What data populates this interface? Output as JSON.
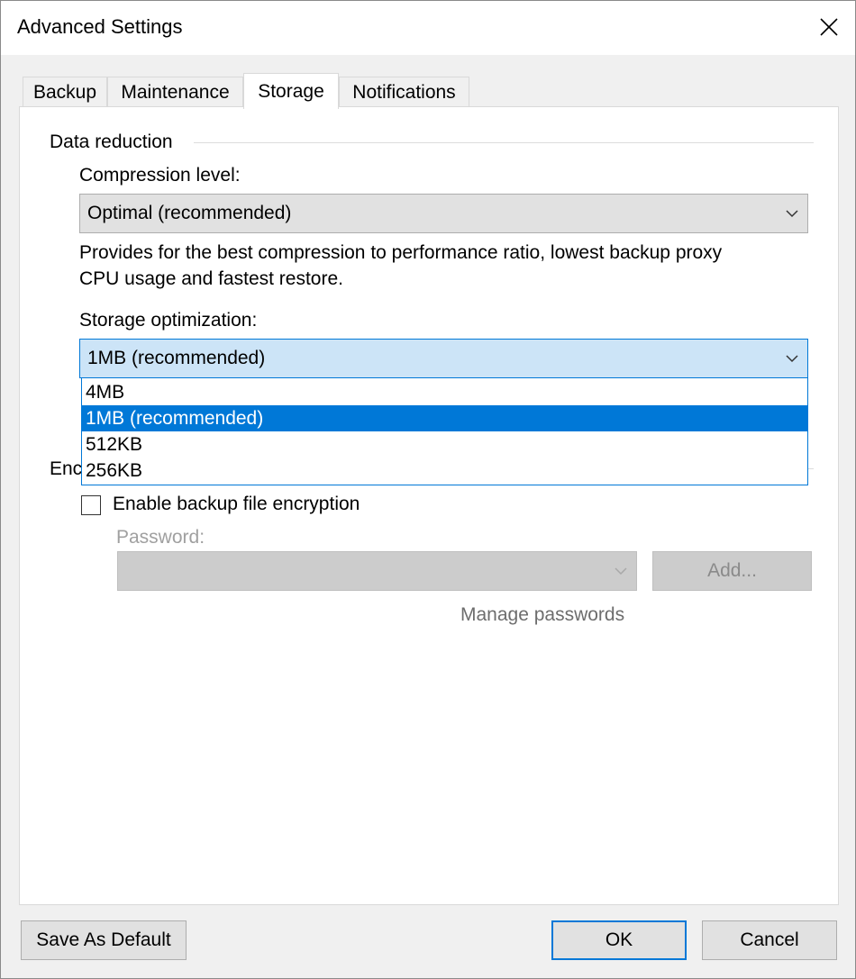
{
  "window": {
    "title": "Advanced Settings"
  },
  "tabs": [
    {
      "label": "Backup"
    },
    {
      "label": "Maintenance"
    },
    {
      "label": "Storage",
      "active": true
    },
    {
      "label": "Notifications"
    }
  ],
  "data_reduction": {
    "group_label": "Data reduction",
    "compression": {
      "label": "Compression level:",
      "value": "Optimal (recommended)",
      "description_line1": "Provides for the best compression to performance ratio, lowest backup proxy",
      "description_line2": "CPU usage and fastest restore."
    },
    "storage_optimization": {
      "label": "Storage optimization:",
      "value": "1MB (recommended)",
      "options": [
        "4MB",
        "1MB (recommended)",
        "512KB",
        "256KB"
      ],
      "selected_index": 1
    }
  },
  "encryption": {
    "group_label": "Encryption",
    "visible_label_fragment": "Enc",
    "checkbox_label": "Enable backup file encryption",
    "checked": false,
    "password_label": "Password:",
    "password_value": "",
    "add_button": "Add...",
    "manage_passwords": "Manage passwords"
  },
  "footer": {
    "save_default": "Save As Default",
    "ok": "OK",
    "cancel": "Cancel"
  },
  "colors": {
    "accent": "#0078d7",
    "selection_bg": "#0078d7",
    "focused_combo_bg": "#cce4f7",
    "button_bg": "#e1e1e1",
    "disabled_bg": "#cccccc"
  },
  "icons": {
    "close": "close-icon",
    "dropdown": "chevron-down-icon"
  }
}
